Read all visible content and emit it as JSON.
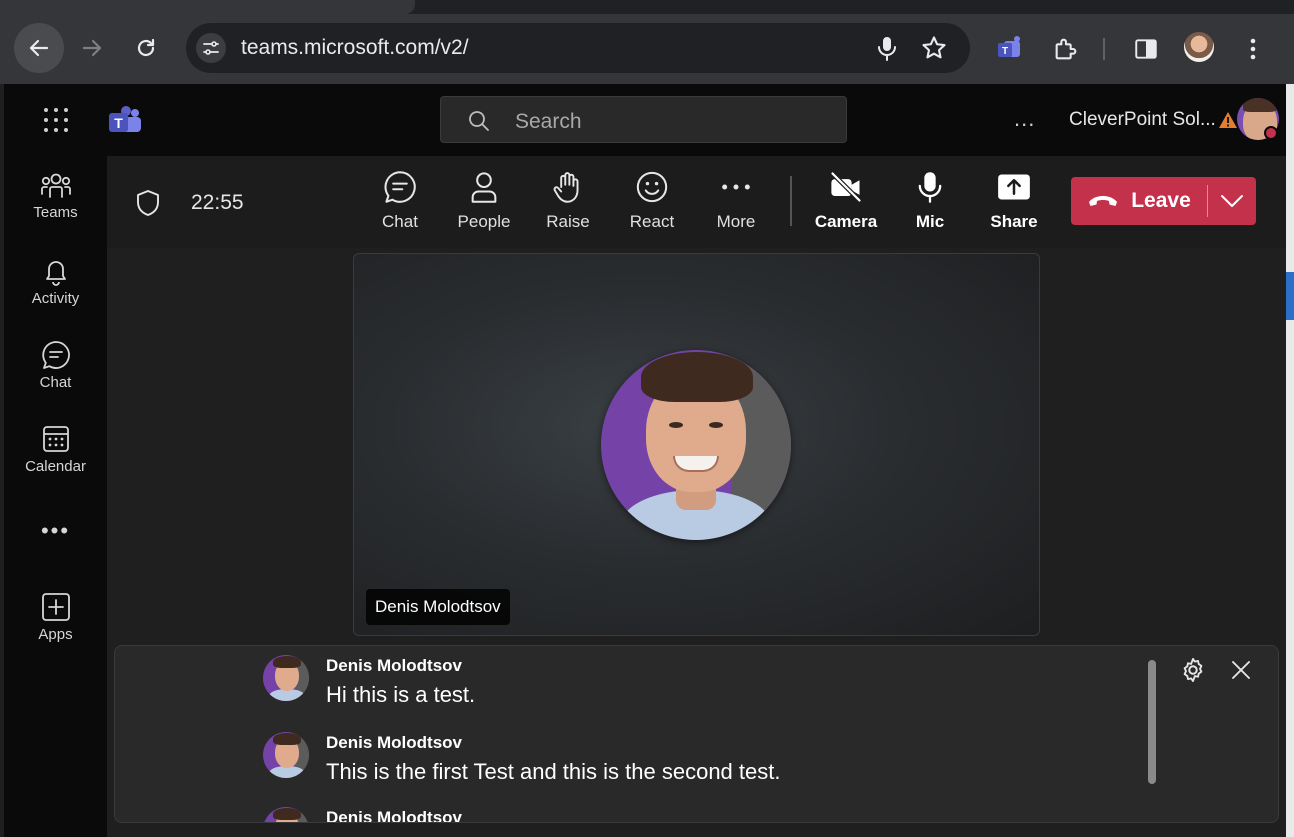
{
  "browser": {
    "url": "teams.microsoft.com/v2/"
  },
  "teams_header": {
    "search_placeholder": "Search",
    "more": "...",
    "org_name": "CleverPoint Sol..."
  },
  "rail": {
    "items": [
      {
        "label": "Teams",
        "icon": "teams-icon"
      },
      {
        "label": "Activity",
        "icon": "bell-icon"
      },
      {
        "label": "Chat",
        "icon": "chat-icon"
      },
      {
        "label": "Calendar",
        "icon": "calendar-icon"
      },
      {
        "label": "Apps",
        "icon": "add-apps-icon"
      }
    ]
  },
  "meeting": {
    "timer": "22:55",
    "buttons": {
      "chat": "Chat",
      "people": "People",
      "raise": "Raise",
      "react": "React",
      "more": "More",
      "camera": "Camera",
      "mic": "Mic",
      "share": "Share"
    },
    "leave": "Leave"
  },
  "stage": {
    "participant_name": "Denis Molodtsov"
  },
  "chat_bubbles": [
    {
      "sender": "Denis Molodtsov",
      "text": "Hi this is a test."
    },
    {
      "sender": "Denis Molodtsov",
      "text": "This is the first Test and this is the second test."
    },
    {
      "sender": "Denis Molodtsov",
      "text": ""
    }
  ],
  "colors": {
    "leave_red": "#c4314b",
    "teams_purple": "#5b5fc7",
    "app_bg": "#1f1f1f"
  }
}
